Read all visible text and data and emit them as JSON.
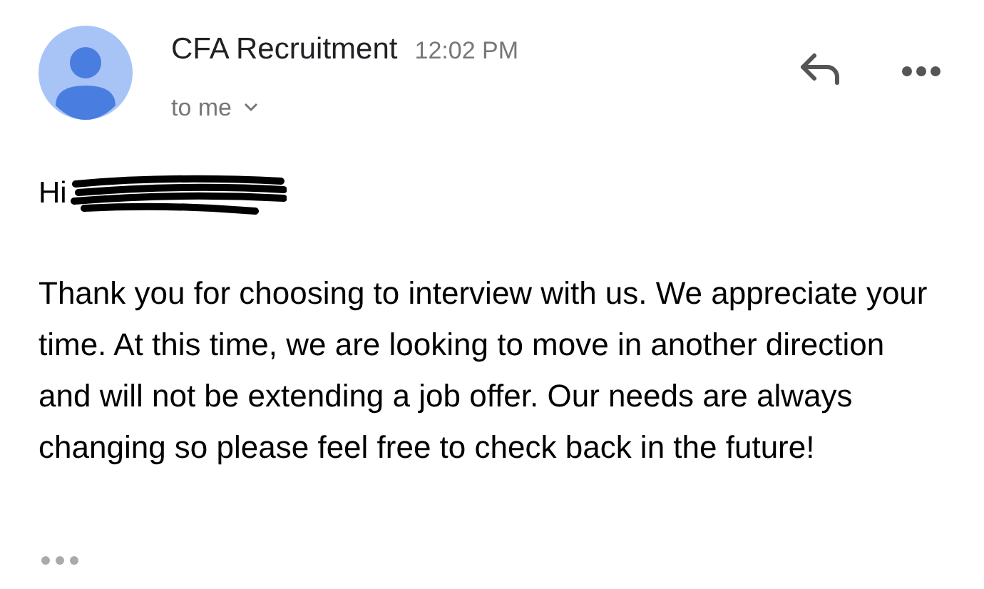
{
  "sender": {
    "name": "CFA Recruitment",
    "time": "12:02 PM",
    "recipient": "to me"
  },
  "greeting": "Hi",
  "body": "Thank you for choosing to interview with us. We appreciate your time. At this time, we are looking to move in another direction and will not be extending a job offer. Our needs are always changing so please feel free to check back in the future!"
}
